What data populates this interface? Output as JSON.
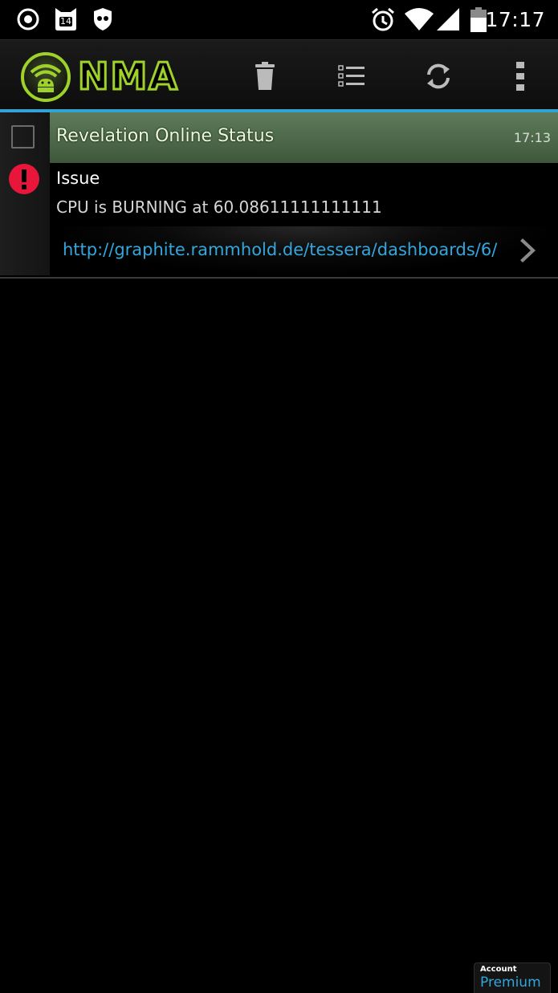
{
  "status_bar": {
    "time": "17:17",
    "notification_badge_count": "14",
    "icons": [
      "circle-dot-icon",
      "cat-badge-icon",
      "incognito-shield-icon",
      "alarm-clock-icon",
      "wifi-icon",
      "cell-signal-icon",
      "battery-icon"
    ]
  },
  "action_bar": {
    "app_logo_text": "NMA",
    "actions": [
      "trash-icon",
      "list-icon",
      "refresh-icon",
      "overflow-menu-icon"
    ]
  },
  "notification": {
    "application": "Revelation Online Status",
    "time": "17:13",
    "event": "Issue",
    "description": "CPU is BURNING at 60.08611111111111",
    "url": "http://graphite.rammhold.de/tessera/dashboards/6/",
    "priority_icon": "exclamation-circle-icon",
    "header_color": "#557252"
  },
  "account": {
    "label": "Account",
    "tier": "Premium"
  },
  "colors": {
    "accent": "#33a3d6",
    "logo_green": "#9ed12a",
    "priority_red": "#e8163a"
  }
}
